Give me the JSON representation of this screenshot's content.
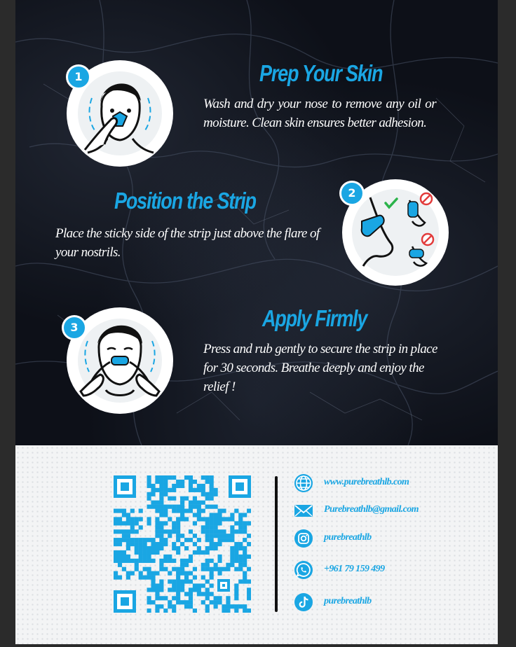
{
  "steps": [
    {
      "number": "1",
      "title": "Prep Your Skin",
      "text": "Wash and dry your nose to remove any oil or moisture. Clean skin ensures better adhesion."
    },
    {
      "number": "2",
      "title": "Position the Strip",
      "text": "Place the sticky side of the strip just above the flare of your nostrils."
    },
    {
      "number": "3",
      "title": "Apply Firmly",
      "text": "Press and rub gently to secure the strip in place for 30 seconds. Breathe deeply and enjoy the relief !"
    }
  ],
  "contacts": [
    {
      "icon": "globe-icon",
      "value": "www.purebreathlb.com"
    },
    {
      "icon": "envelope-icon",
      "value": "Purebreathlb@gmail.com"
    },
    {
      "icon": "instagram-icon",
      "value": "purebreathlb"
    },
    {
      "icon": "whatsapp-icon",
      "value": "+961 79 159 499"
    },
    {
      "icon": "tiktok-icon",
      "value": "purebreathlb"
    }
  ],
  "colors": {
    "accent": "#1aa6e3",
    "dark_background": "#0d1018",
    "light_background": "#f3f4f5",
    "text_light": "#ffffff"
  }
}
